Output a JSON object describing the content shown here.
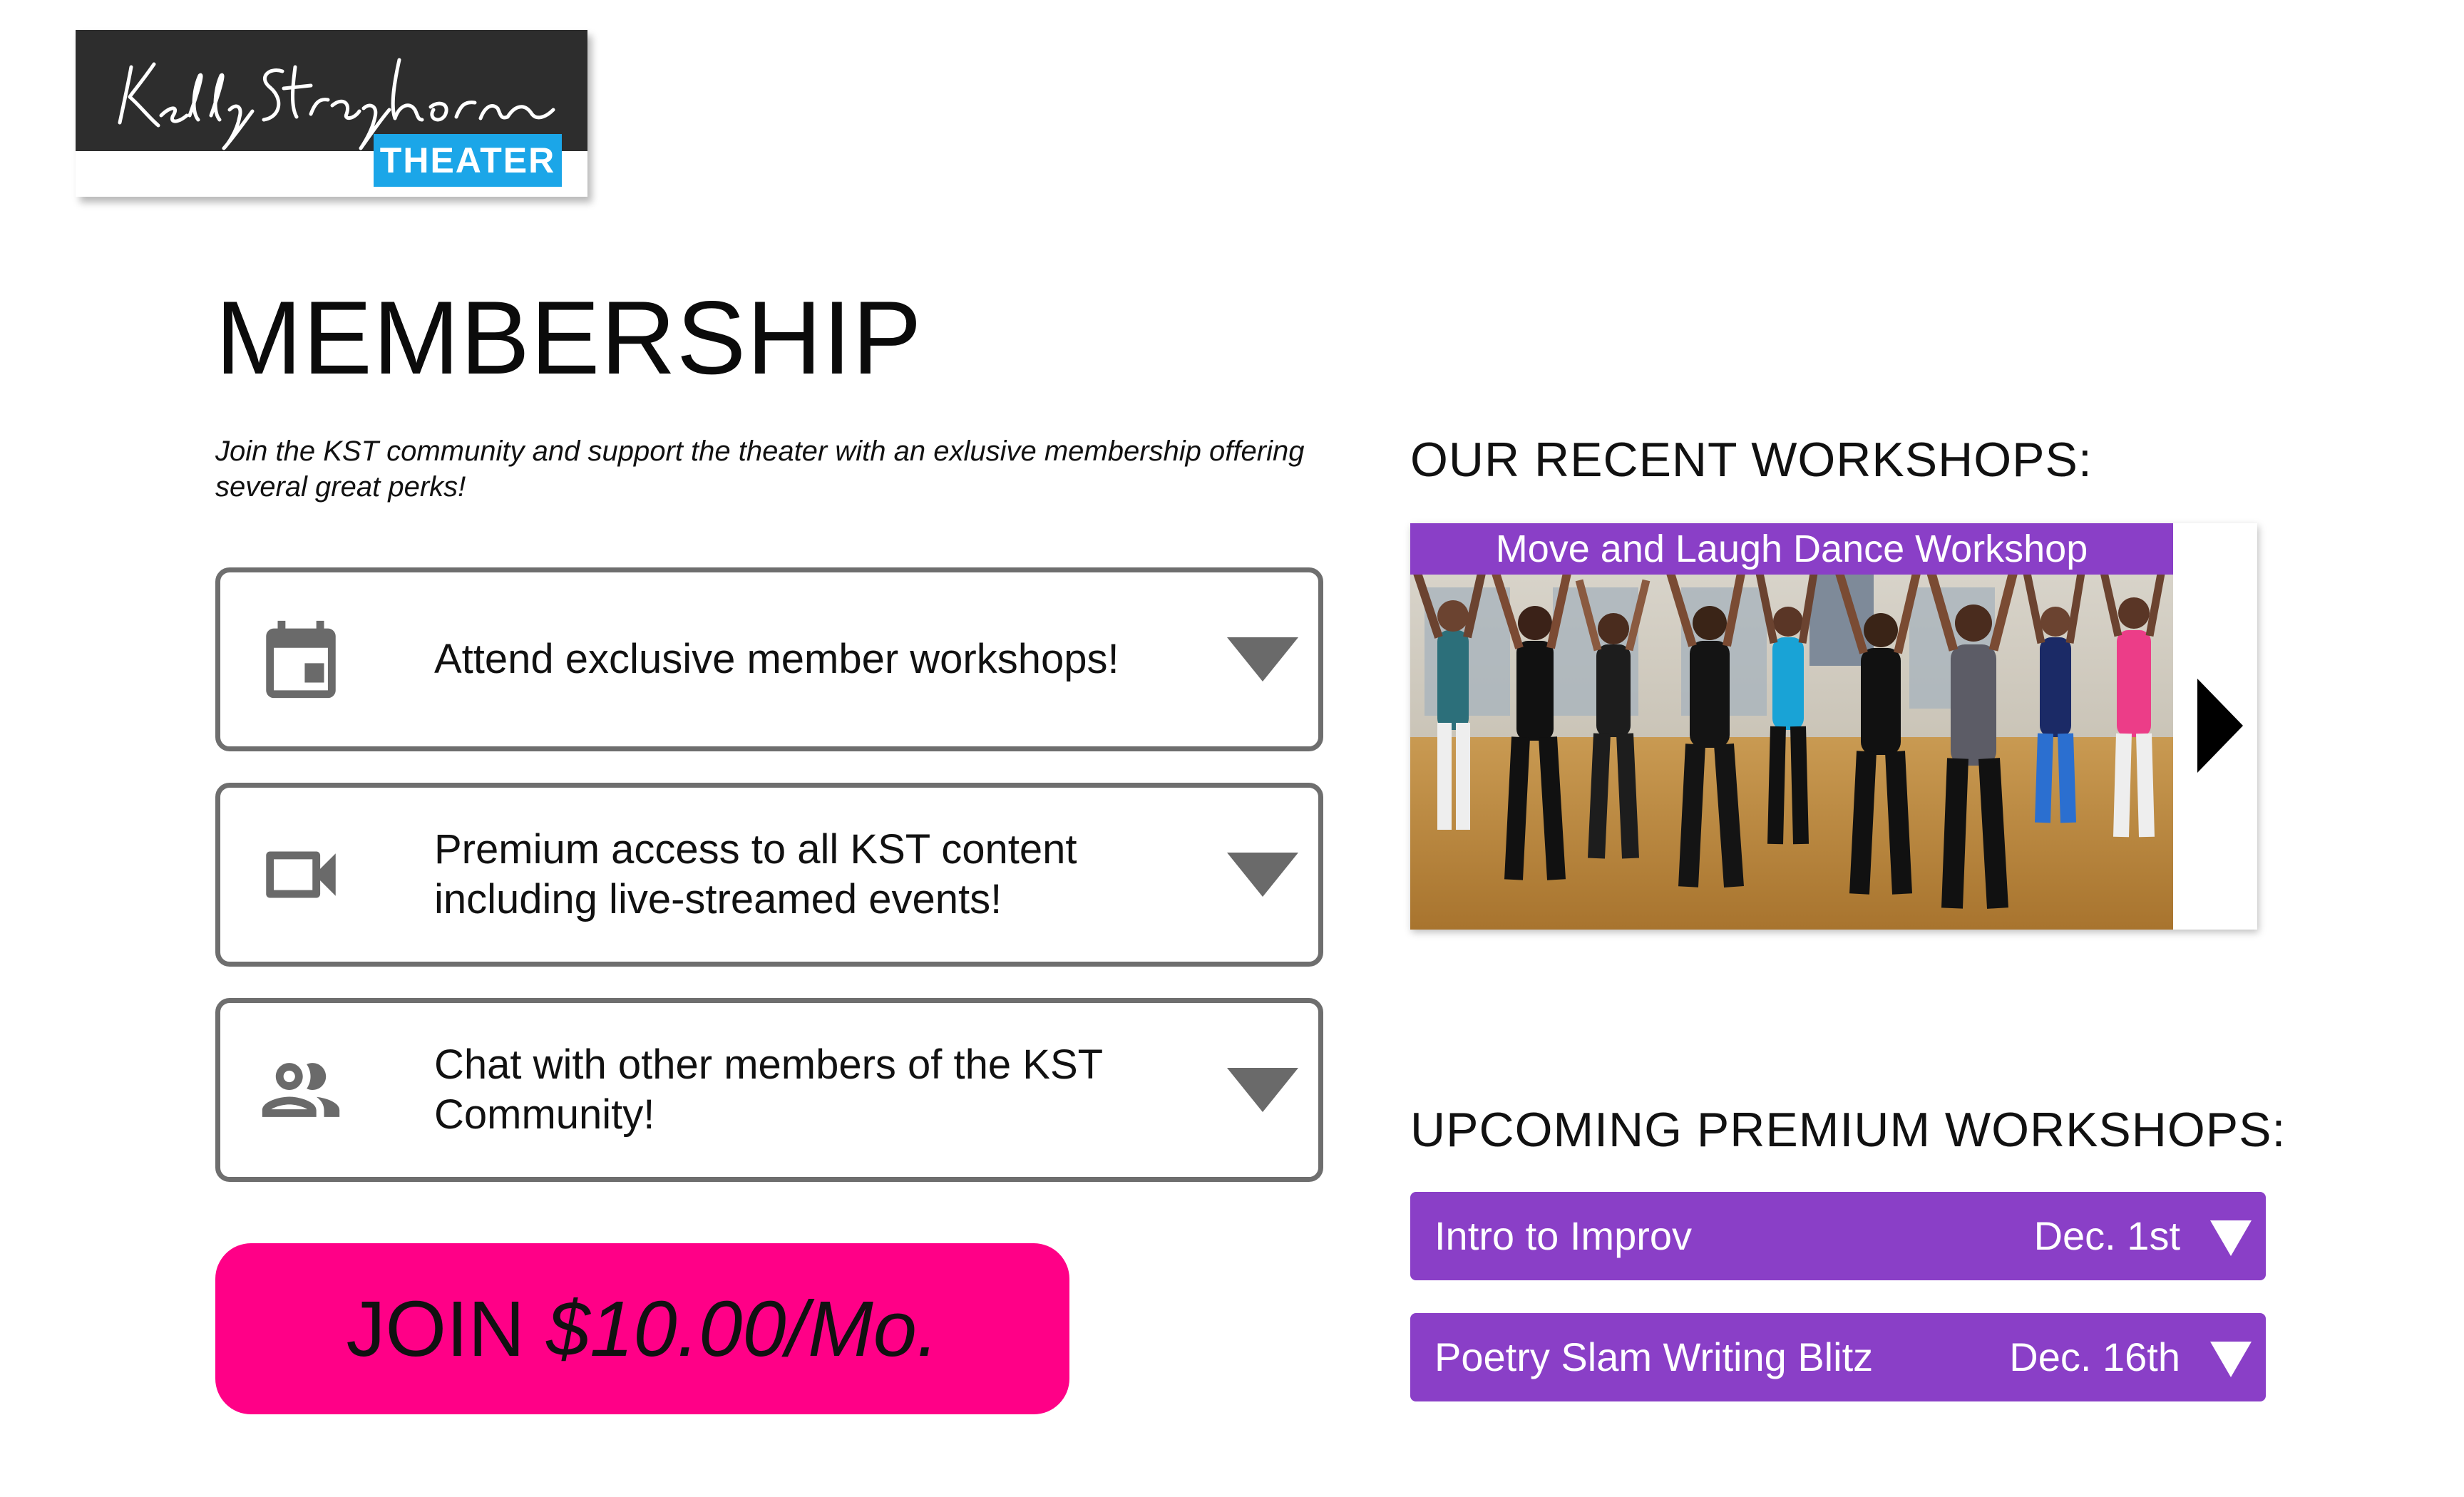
{
  "logo": {
    "script_text": "Kelly Strayhorn",
    "badge": "THEATER"
  },
  "page": {
    "title": "MEMBERSHIP",
    "intro": "Join the KST community and support the theater with an exlusive membership offering several great perks!"
  },
  "perks": [
    {
      "icon": "calendar-icon",
      "text": "Attend exclusive member workshops!"
    },
    {
      "icon": "video-camera-icon",
      "text": "Premium access to all KST content including live-streamed events!"
    },
    {
      "icon": "people-icon",
      "text": "Chat with other members of the KST Community!"
    }
  ],
  "join": {
    "label": "JOIN",
    "price": "$10.00/Mo."
  },
  "recent": {
    "heading": "OUR RECENT WORKSHOPS:",
    "slide_caption": "Move and Laugh  Dance Workshop"
  },
  "upcoming": {
    "heading": "UPCOMING PREMIUM WORKSHOPS:",
    "items": [
      {
        "name": "Intro to Improv",
        "date": "Dec. 1st"
      },
      {
        "name": "Poetry Slam Writing Blitz",
        "date": "Dec. 16th"
      }
    ]
  },
  "colors": {
    "join_pink": "#ff0087",
    "workshop_purple": "#8a3fc7",
    "logo_blue": "#1ba6e8",
    "border_gray": "#6e6e6e"
  }
}
